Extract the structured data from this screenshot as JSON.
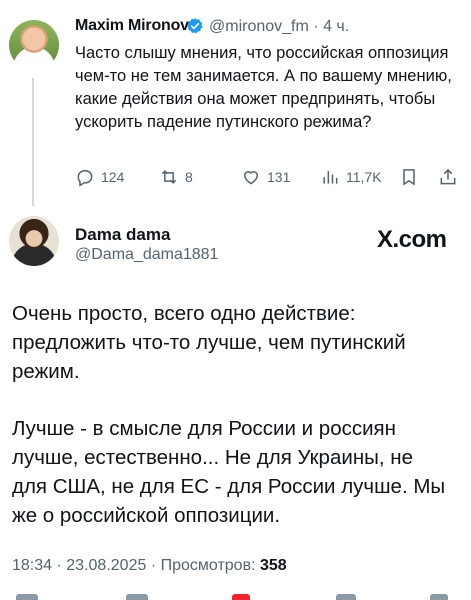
{
  "parent_tweet": {
    "author_name": "Maxim Mironov",
    "author_handle": "@mironov_fm",
    "time_sep": "·",
    "time": "4 ч.",
    "text": "Часто слышу мнения, что российская оппозиция чем-то не тем занимается. А по вашему мнению, какие действия она может предпринять, чтобы ускорить падение путинского режима?",
    "replies": "124",
    "reposts": "8",
    "likes": "131",
    "views": "11,7K"
  },
  "reply_tweet": {
    "author_name": "Dama dama",
    "author_handle": "@Dama_dama1881",
    "brand": "X.com",
    "paragraph1": "Очень просто, всего одно действие: предложить что-то лучше, чем путинский режим.",
    "paragraph2": "Лучше - в смысле для России и россиян лучше, естественно... Не для Украины, не для США, не для ЕС - для России лучше. Мы же о российской оппозиции.",
    "time": "18:34",
    "date": "23.08.2025",
    "views_label": "Просмотров:",
    "views_count": "358"
  },
  "colors": {
    "text": "#0f1419",
    "secondary": "#536471",
    "verified": "#1d9bf0"
  },
  "icons": [
    "reply-icon",
    "repost-icon",
    "like-icon",
    "views-icon",
    "bookmark-icon",
    "share-icon",
    "verified-badge-icon"
  ]
}
